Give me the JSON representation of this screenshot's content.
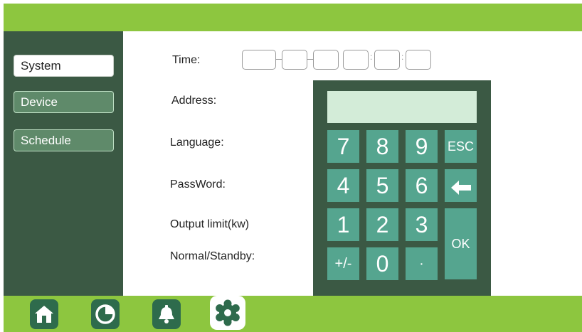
{
  "colors": {
    "accent": "#8dc63f",
    "sidebar": "#3b5944",
    "key": "#55a58f",
    "display": "#d3ecd8"
  },
  "sidebar": {
    "items": [
      {
        "label": "System",
        "active": true
      },
      {
        "label": "Device",
        "active": false
      },
      {
        "label": "Schedule",
        "active": false
      }
    ]
  },
  "settings": {
    "time_label": "Time:",
    "address_label": "Address:",
    "language_label": "Language:",
    "password_label": "PassWord:",
    "output_limit_label": "Output limit(kw)",
    "mode_label": "Normal/Standby:"
  },
  "keypad": {
    "display_value": "",
    "keys": {
      "k7": "7",
      "k8": "8",
      "k9": "9",
      "esc": "ESC",
      "k4": "4",
      "k5": "5",
      "k6": "6",
      "backspace": "←",
      "k1": "1",
      "k2": "2",
      "k3": "3",
      "ok": "OK",
      "sign": "+/-",
      "k0": "0",
      "dot": "·"
    }
  },
  "bottom_nav": {
    "items": [
      {
        "icon": "home-icon"
      },
      {
        "icon": "pie-chart-icon"
      },
      {
        "icon": "bell-icon"
      },
      {
        "icon": "gear-icon",
        "active": true
      }
    ]
  }
}
